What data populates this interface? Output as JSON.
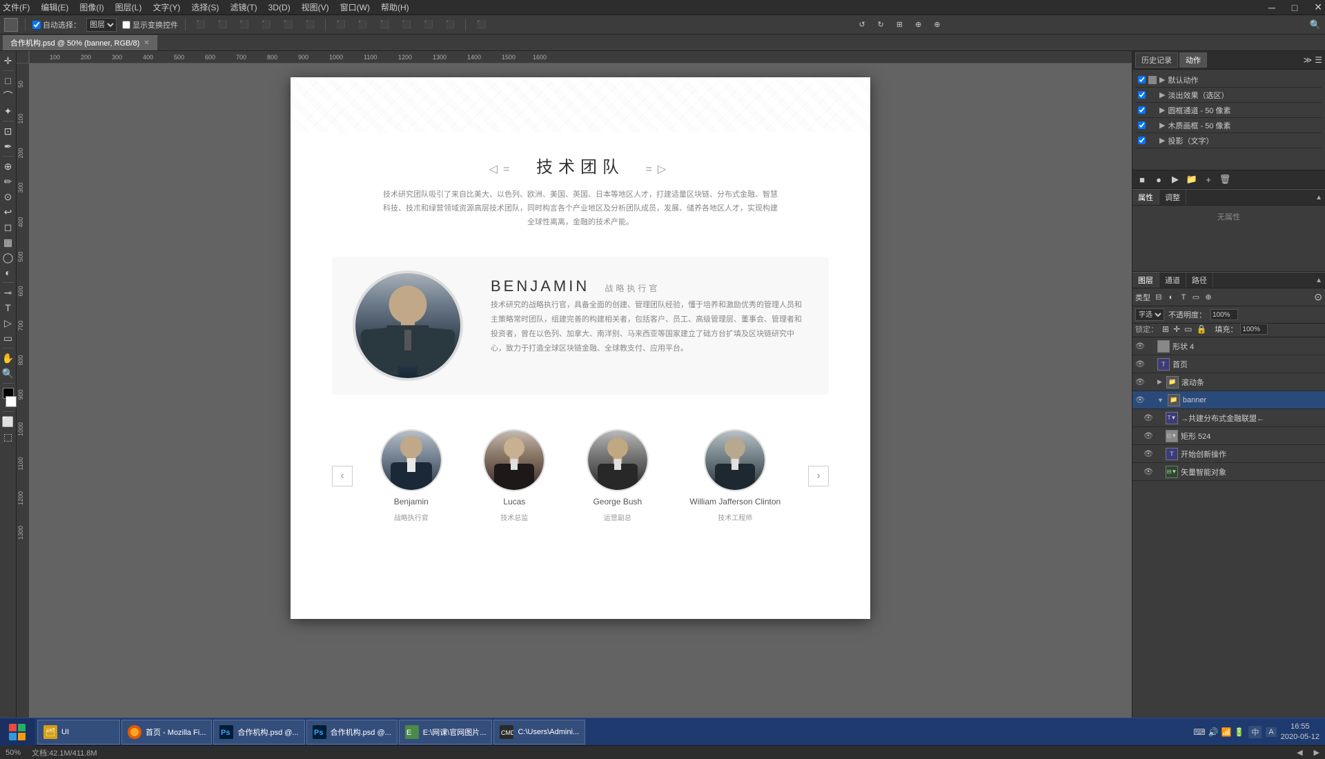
{
  "window": {
    "title": "合作机构.psd @ 50% (banner, RGB/8)",
    "min": "─",
    "max": "□",
    "close": "✕"
  },
  "menu": {
    "items": [
      "文件(F)",
      "编辑(E)",
      "图像(I)",
      "图层(L)",
      "文字(Y)",
      "选择(S)",
      "滤镜(T)",
      "3D(D)",
      "视图(V)",
      "窗口(W)",
      "帮助(H)"
    ]
  },
  "toolbar": {
    "auto_select_label": "自动选择：",
    "auto_select_value": "图层",
    "show_transform": "显示变换控件",
    "zoom_label": "50%"
  },
  "tab": {
    "filename": "合作机构.psd @ 50% (banner, RGB/8)",
    "close": "✕"
  },
  "canvas": {
    "section_title": "技术团队",
    "section_title_left_deco": "◁=",
    "section_title_right_deco": "=▷",
    "section_desc": "技术研究团队吸引了来自比美大、以色列、欧洲、美国、英国、日本等地区人才，打建适量区块链、分布式金融、智慧科技、技朮和绿营领域资源高层技术团队，同时构言各个产业地区及分析团队成员，发展、储养各地区人才，实现构建全球性离离，金融的技术产能。",
    "featured": {
      "name": "BENJAMIN",
      "title": "战略执行官",
      "desc": "技术研究的战略执行官，具备全面的创建、管理团队经验，懂于培养和激励优秀的管理人员和主策略常时团队，组建完善的构建相关者，包括客户、员工、高级管理层、董事会、管理者和投资者，曾在以色列、加拿大、南洋别、马来西亚等国家建立了础方台扩填及区块链研究中心，致力于打造全球区块链金融、全球教支付、应用平台。"
    },
    "team_members": [
      {
        "name": "Benjamin",
        "role": "战略执行官",
        "avatar_class": "avatar-benjamin"
      },
      {
        "name": "Lucas",
        "role": "技术总监",
        "avatar_class": "avatar-lucas"
      },
      {
        "name": "George Bush",
        "role": "运营副总",
        "avatar_class": "avatar-george"
      },
      {
        "name": "William Jafferson Clinton",
        "role": "技术工程师",
        "avatar_class": "avatar-william"
      }
    ]
  },
  "right_panel": {
    "tabs_top": [
      "历史记录",
      "动作"
    ],
    "actions_title": "默认动作",
    "actions": [
      {
        "name": "淡出效果（选区）",
        "checked": true
      },
      {
        "name": "圆框通道 - 50 像素",
        "checked": true
      },
      {
        "name": "木质画框 - 50 像素",
        "checked": true
      },
      {
        "name": "投影（文字）",
        "checked": true
      }
    ],
    "panel_tabs": [
      "属性",
      "调整"
    ],
    "no_props": "无属性",
    "bottom_tabs": [
      "图层",
      "通道",
      "路径"
    ],
    "layer_type": "类型",
    "opacity_label": "不透明度：",
    "opacity_value": "100%",
    "fill_label": "填充：",
    "fill_value": "100%",
    "blend_mode": "字选",
    "layers": [
      {
        "name": "形状 4",
        "type": "shape",
        "visible": true,
        "selected": false,
        "indent": 0
      },
      {
        "name": "首页",
        "type": "text",
        "visible": true,
        "selected": false,
        "indent": 0
      },
      {
        "name": "滚动条",
        "type": "folder",
        "visible": true,
        "selected": false,
        "indent": 0
      },
      {
        "name": "banner",
        "type": "folder",
        "visible": true,
        "selected": true,
        "indent": 0
      },
      {
        "name": "→共建分布式金融联盟←",
        "type": "text",
        "visible": true,
        "selected": false,
        "indent": 1
      },
      {
        "name": "矩形 524",
        "type": "shape",
        "visible": true,
        "selected": false,
        "indent": 1
      },
      {
        "name": "开始创新操作",
        "type": "text",
        "visible": true,
        "selected": false,
        "indent": 1
      },
      {
        "name": "矢量智能对象",
        "type": "smart",
        "visible": true,
        "selected": false,
        "indent": 1
      }
    ]
  },
  "status_bar": {
    "zoom": "50%",
    "file_info": "文档:42.1M/411.8M"
  },
  "taskbar": {
    "items": [
      {
        "label": "UI",
        "icon": "explorer"
      },
      {
        "label": "首页 - Mozilla Fi...",
        "icon": "firefox"
      },
      {
        "label": "合作机构.psd @...",
        "icon": "ps"
      },
      {
        "label": "合作机构.psd @...",
        "icon": "ps2"
      },
      {
        "label": "E:\\网课\\官网图片...",
        "icon": "app"
      },
      {
        "label": "C:\\Users\\Admini...",
        "icon": "win"
      }
    ],
    "time": "16:55",
    "date": "2020-05-12",
    "lang": "中",
    "input_mode": "A"
  }
}
